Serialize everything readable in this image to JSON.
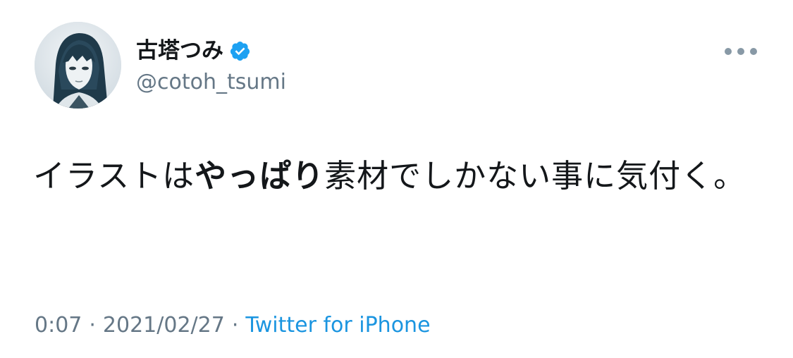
{
  "tweet": {
    "user": {
      "display_name": "古塔つみ",
      "handle": "@cotoh_tsumi",
      "verified": true,
      "avatar_icon": "avatar-illustration"
    },
    "more_icon": "more-options-icon",
    "text": {
      "part1": "イラストは",
      "part2_bold": "やっぱり",
      "part3": "素材でしかない事に気付く。"
    },
    "meta": {
      "time": "0:07",
      "separator": "·",
      "date": "2021/02/27",
      "source": "Twitter for iPhone"
    }
  },
  "colors": {
    "verified_blue": "#1da1f2",
    "link_blue": "#1b95e0",
    "secondary_text": "#657786",
    "primary_text": "#14171a"
  }
}
